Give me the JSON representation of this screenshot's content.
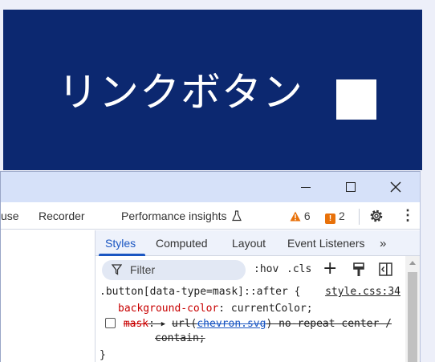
{
  "page_preview": {
    "button_label": "リンクボタン",
    "button_background": "#0c2870",
    "button_text_color": "#ffffff"
  },
  "window_controls": {
    "minimize_icon": "minimize-icon",
    "maximize_icon": "maximize-icon",
    "close_icon": "close-icon"
  },
  "toolbar": {
    "tabs": [
      "use",
      "Recorder",
      "Performance insights"
    ],
    "warnings_count": "6",
    "issues_count": "2",
    "settings_icon": "gear-icon",
    "more_icon": "kebab-menu-icon"
  },
  "styles_pane": {
    "tabs": [
      "Styles",
      "Computed",
      "Layout",
      "Event Listeners",
      "»"
    ],
    "active_tab": "Styles",
    "filter_placeholder": "Filter",
    "hov_label": ":hov",
    "cls_label": ".cls",
    "rule": {
      "selector": ".button[data-type=mask]::after {",
      "source": "style.css:34",
      "declarations": [
        {
          "property": "background-color",
          "value": "currentColor;",
          "struck": false
        },
        {
          "property": "mask",
          "value_prefix": "url(",
          "value_link": "chevron.svg",
          "value_suffix": ") no-repeat center /",
          "value_cont": "contain;",
          "struck": true
        }
      ],
      "close": "}"
    }
  },
  "colors": {
    "accent": "#1a56c2",
    "titlebar": "#d6e1f9",
    "warning": "#e8710a",
    "property_red": "#c80000"
  }
}
